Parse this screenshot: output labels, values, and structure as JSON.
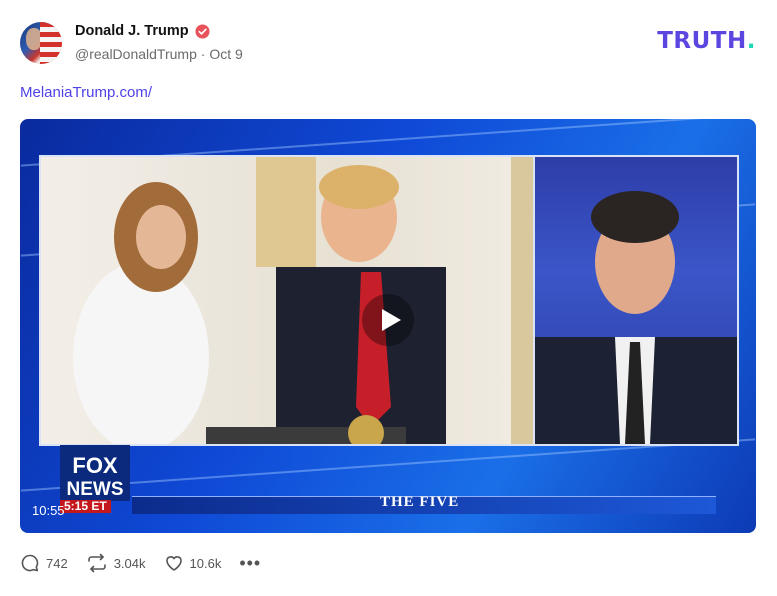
{
  "post": {
    "author_name": "Donald J. Trump",
    "handle": "@realDonaldTrump",
    "date": "Oct 9",
    "link_text": "MelaniaTrump.com/"
  },
  "brand": {
    "logo_main": "TRUTH",
    "logo_dot": "."
  },
  "video": {
    "network_logo_line1": "FOX",
    "network_logo_line2": "NEWS",
    "time_badge": "5:15 ET",
    "show_name": "THE FIVE",
    "duration": "10:55"
  },
  "actions": {
    "replies": "742",
    "retruths": "3.04k",
    "likes": "10.6k",
    "more_label": "•••"
  },
  "colors": {
    "accent": "#5b46e0",
    "accent_dot": "#20d6b5",
    "verified": "#e8525a",
    "link": "#4f42e6"
  }
}
